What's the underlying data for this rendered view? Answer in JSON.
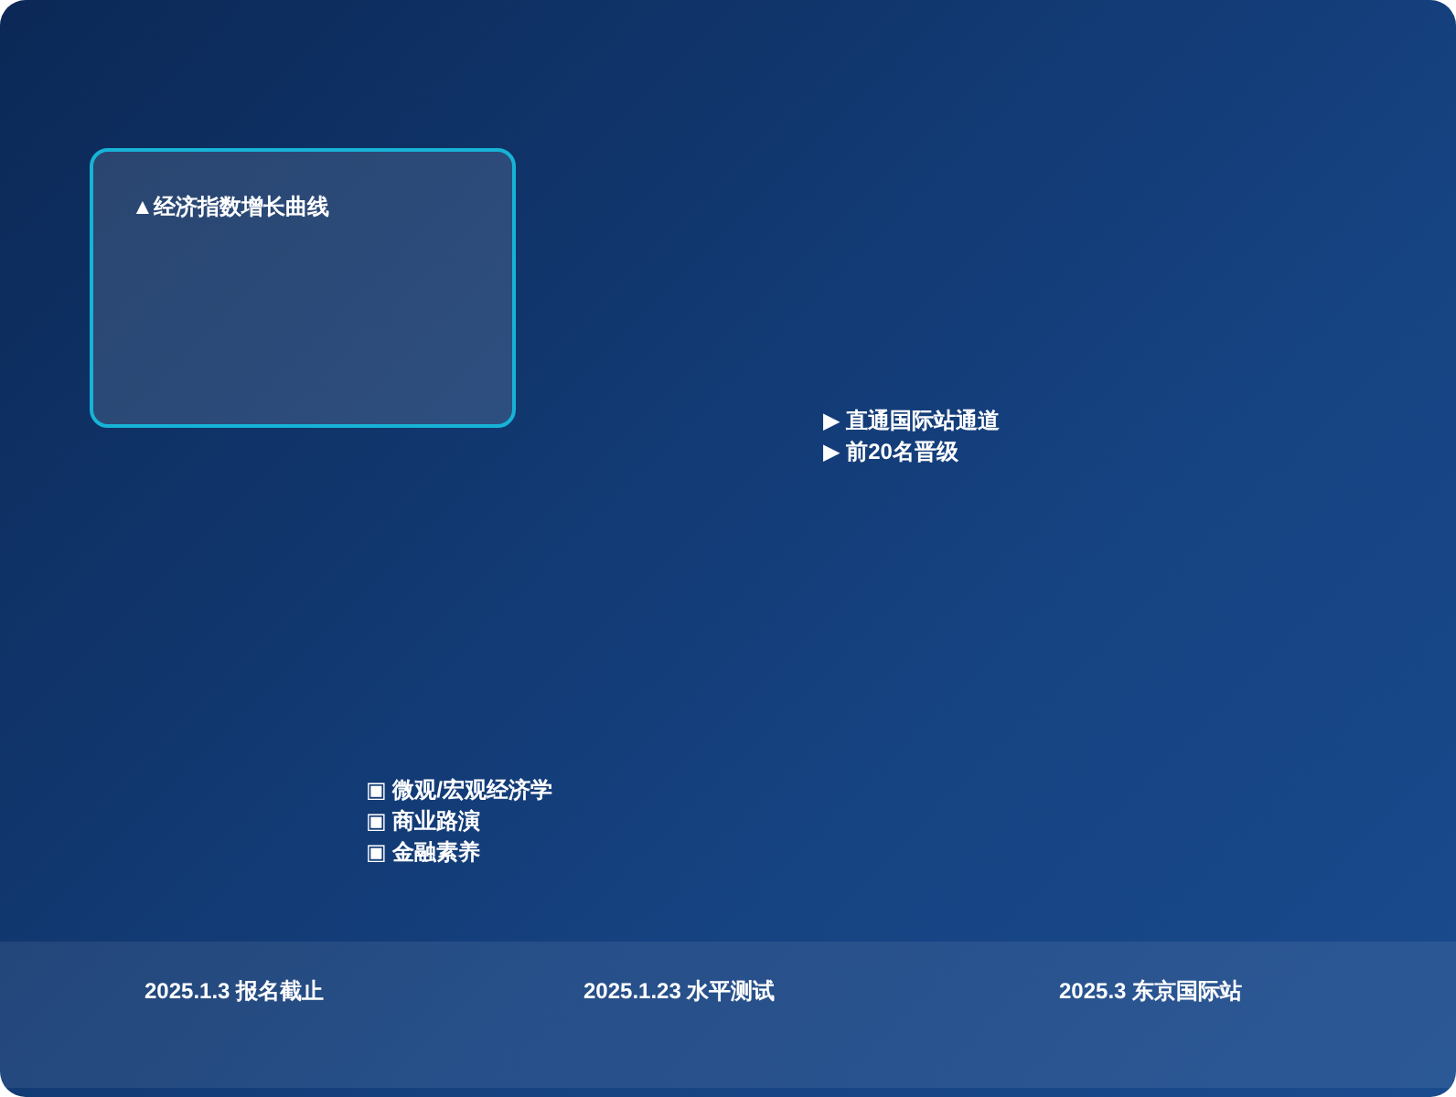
{
  "chart_card": {
    "title": "▲经济指数增长曲线"
  },
  "highlights": [
    {
      "marker": "▶",
      "text": "直通国际站通道"
    },
    {
      "marker": "▶",
      "text": "前20名晋级"
    }
  ],
  "topics": [
    {
      "marker": "▣",
      "text": "微观/宏观经济学"
    },
    {
      "marker": "▣",
      "text": "商业路演"
    },
    {
      "marker": "▣",
      "text": "金融素养"
    }
  ],
  "timeline": [
    {
      "date": "2025.1.3",
      "event": "报名截止"
    },
    {
      "date": "2025.1.23",
      "event": "水平测试"
    },
    {
      "date": "2025.3",
      "event": "东京国际站"
    }
  ]
}
